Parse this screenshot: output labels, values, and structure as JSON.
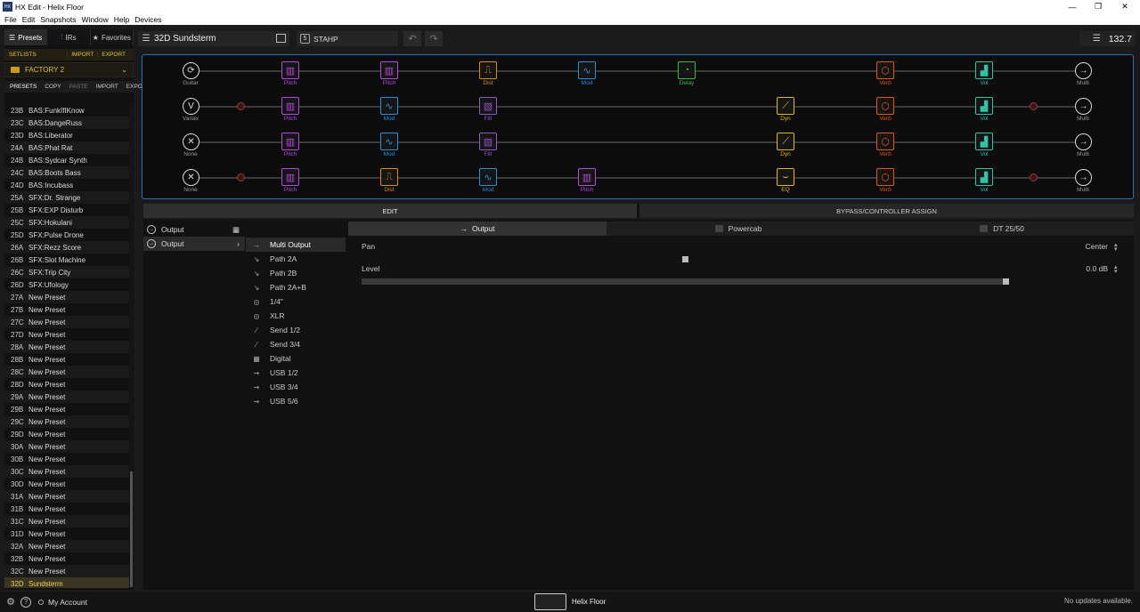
{
  "window": {
    "title": "HX Edit - Helix Floor",
    "app_icon": "HX"
  },
  "menu": [
    "File",
    "Edit",
    "Snapshots",
    "Window",
    "Help",
    "Devices"
  ],
  "left": {
    "tabs": [
      "Presets",
      "IRs",
      "Favorites"
    ],
    "setlists_label": "SETLISTS",
    "setlists_actions": [
      "IMPORT",
      "EXPORT"
    ],
    "setlist_selected": "FACTORY 2",
    "presets_label": "PRESETS",
    "presets_actions": [
      "COPY",
      "PASTE",
      "IMPORT",
      "EXPORT"
    ],
    "presets": [
      {
        "n": "23B",
        "name": "BAS:FunkIfIKnow"
      },
      {
        "n": "23C",
        "name": "BAS:DangeRuss"
      },
      {
        "n": "23D",
        "name": "BAS:Liberator"
      },
      {
        "n": "24A",
        "name": "BAS:Phat Rat"
      },
      {
        "n": "24B",
        "name": "BAS:Sydcar Synth"
      },
      {
        "n": "24C",
        "name": "BAS:Boots Bass"
      },
      {
        "n": "24D",
        "name": "BAS:Incubass"
      },
      {
        "n": "25A",
        "name": "SFX:Dr. Strange"
      },
      {
        "n": "25B",
        "name": "SFX:EXP Disturb"
      },
      {
        "n": "25C",
        "name": "SFX:Hokulani"
      },
      {
        "n": "25D",
        "name": "SFX:Pulse Drone"
      },
      {
        "n": "26A",
        "name": "SFX:Rezz Score"
      },
      {
        "n": "26B",
        "name": "SFX:Slot Machine"
      },
      {
        "n": "26C",
        "name": "SFX:Trip City"
      },
      {
        "n": "26D",
        "name": "SFX:Ufology"
      },
      {
        "n": "27A",
        "name": "New Preset"
      },
      {
        "n": "27B",
        "name": "New Preset"
      },
      {
        "n": "27C",
        "name": "New Preset"
      },
      {
        "n": "27D",
        "name": "New Preset"
      },
      {
        "n": "28A",
        "name": "New Preset"
      },
      {
        "n": "28B",
        "name": "New Preset"
      },
      {
        "n": "28C",
        "name": "New Preset"
      },
      {
        "n": "28D",
        "name": "New Preset"
      },
      {
        "n": "29A",
        "name": "New Preset"
      },
      {
        "n": "29B",
        "name": "New Preset"
      },
      {
        "n": "29C",
        "name": "New Preset"
      },
      {
        "n": "29D",
        "name": "New Preset"
      },
      {
        "n": "30A",
        "name": "New Preset"
      },
      {
        "n": "30B",
        "name": "New Preset"
      },
      {
        "n": "30C",
        "name": "New Preset"
      },
      {
        "n": "30D",
        "name": "New Preset"
      },
      {
        "n": "31A",
        "name": "New Preset"
      },
      {
        "n": "31B",
        "name": "New Preset"
      },
      {
        "n": "31C",
        "name": "New Preset"
      },
      {
        "n": "31D",
        "name": "New Preset"
      },
      {
        "n": "32A",
        "name": "New Preset"
      },
      {
        "n": "32B",
        "name": "New Preset"
      },
      {
        "n": "32C",
        "name": "New Preset"
      },
      {
        "n": "32D",
        "name": "Sundsterm",
        "selected": true
      }
    ]
  },
  "toolbar": {
    "preset_name": "32D  Sundsterm",
    "snapshot_num": "5",
    "snapshot_name": "STAHP",
    "tempo": "132.7"
  },
  "signal": {
    "colors": {
      "pitch": "#b44ad8",
      "dist": "#e08a1f",
      "mod": "#2a8fd8",
      "delay": "#3bb84a",
      "verb": "#e0581f",
      "vol": "#2fc3a8",
      "filter": "#8a5ac8",
      "dyn": "#e0b81f",
      "eq": "#e0b81f",
      "io": "#aaaaaa",
      "split": "#9a3b3b"
    },
    "rows": [
      {
        "input": "Guitar",
        "output": "Multi",
        "blocks": [
          {
            "col": 1,
            "type": "pitch",
            "label": "Pitch"
          },
          {
            "col": 2,
            "type": "pitch",
            "label": "Pitch"
          },
          {
            "col": 3,
            "type": "dist",
            "label": "Dist"
          },
          {
            "col": 4,
            "type": "mod",
            "label": "Mod"
          },
          {
            "col": 5,
            "type": "delay",
            "label": "Delay"
          },
          {
            "col": 7,
            "type": "verb",
            "label": "Verb"
          },
          {
            "col": 8,
            "type": "vol",
            "label": "Vol"
          }
        ]
      },
      {
        "input": "Variax",
        "output": "Multi",
        "blocks": [
          {
            "col": 1,
            "type": "pitch",
            "label": "Pitch"
          },
          {
            "col": 2,
            "type": "mod",
            "label": "Mod"
          },
          {
            "col": 3,
            "type": "filter",
            "label": "Filt"
          },
          {
            "col": 6,
            "type": "dyn",
            "label": "Dyn"
          },
          {
            "col": 7,
            "type": "verb",
            "label": "Verb"
          },
          {
            "col": 8,
            "type": "vol",
            "label": "Vol"
          }
        ]
      },
      {
        "input": "None",
        "output": "Multi",
        "blocks": [
          {
            "col": 1,
            "type": "pitch",
            "label": "Pitch"
          },
          {
            "col": 2,
            "type": "mod",
            "label": "Mod"
          },
          {
            "col": 3,
            "type": "filter",
            "label": "Filt"
          },
          {
            "col": 6,
            "type": "dyn",
            "label": "Dyn"
          },
          {
            "col": 7,
            "type": "verb",
            "label": "Verb"
          },
          {
            "col": 8,
            "type": "vol",
            "label": "Vol"
          }
        ]
      },
      {
        "input": "None",
        "output": "Multi",
        "blocks": [
          {
            "col": 1,
            "type": "pitch",
            "label": "Pitch"
          },
          {
            "col": 2,
            "type": "dist",
            "label": "Dist"
          },
          {
            "col": 3,
            "type": "mod",
            "label": "Mod"
          },
          {
            "col": 4,
            "type": "pitch",
            "label": "Pitch"
          },
          {
            "col": 6,
            "type": "eq",
            "label": "EQ"
          },
          {
            "col": 7,
            "type": "verb",
            "label": "Verb"
          },
          {
            "col": 8,
            "type": "vol",
            "label": "Vol"
          }
        ]
      }
    ]
  },
  "tabs": {
    "edit": "EDIT",
    "bypass": "BYPASS/CONTROLLER ASSIGN"
  },
  "edit": {
    "col1": [
      {
        "label": "Output"
      },
      {
        "label": "Output"
      }
    ],
    "outputs": [
      {
        "icon": "→",
        "label": "Multi Output",
        "selected": true
      },
      {
        "icon": "↘",
        "label": "Path 2A"
      },
      {
        "icon": "↘",
        "label": "Path 2B"
      },
      {
        "icon": "↘",
        "label": "Path 2A+B"
      },
      {
        "icon": "◎",
        "label": "1/4\""
      },
      {
        "icon": "◎",
        "label": "XLR"
      },
      {
        "icon": "⁄",
        "label": "Send 1/2"
      },
      {
        "icon": "⁄",
        "label": "Send 3/4"
      },
      {
        "icon": "▦",
        "label": "Digital"
      },
      {
        "icon": "⇝",
        "label": "USB 1/2"
      },
      {
        "icon": "⇝",
        "label": "USB 3/4"
      },
      {
        "icon": "⇝",
        "label": "USB 5/6"
      }
    ],
    "param_tabs": [
      "Output",
      "Powercab",
      "DT 25/50"
    ],
    "params": [
      {
        "name": "Pan",
        "value": "Center",
        "pos": 0.5
      },
      {
        "name": "Level",
        "value": "0.0 dB",
        "pos": 1.0
      }
    ]
  },
  "status": {
    "account": "My Account",
    "device": "Helix Floor",
    "updates": "No updates available."
  }
}
